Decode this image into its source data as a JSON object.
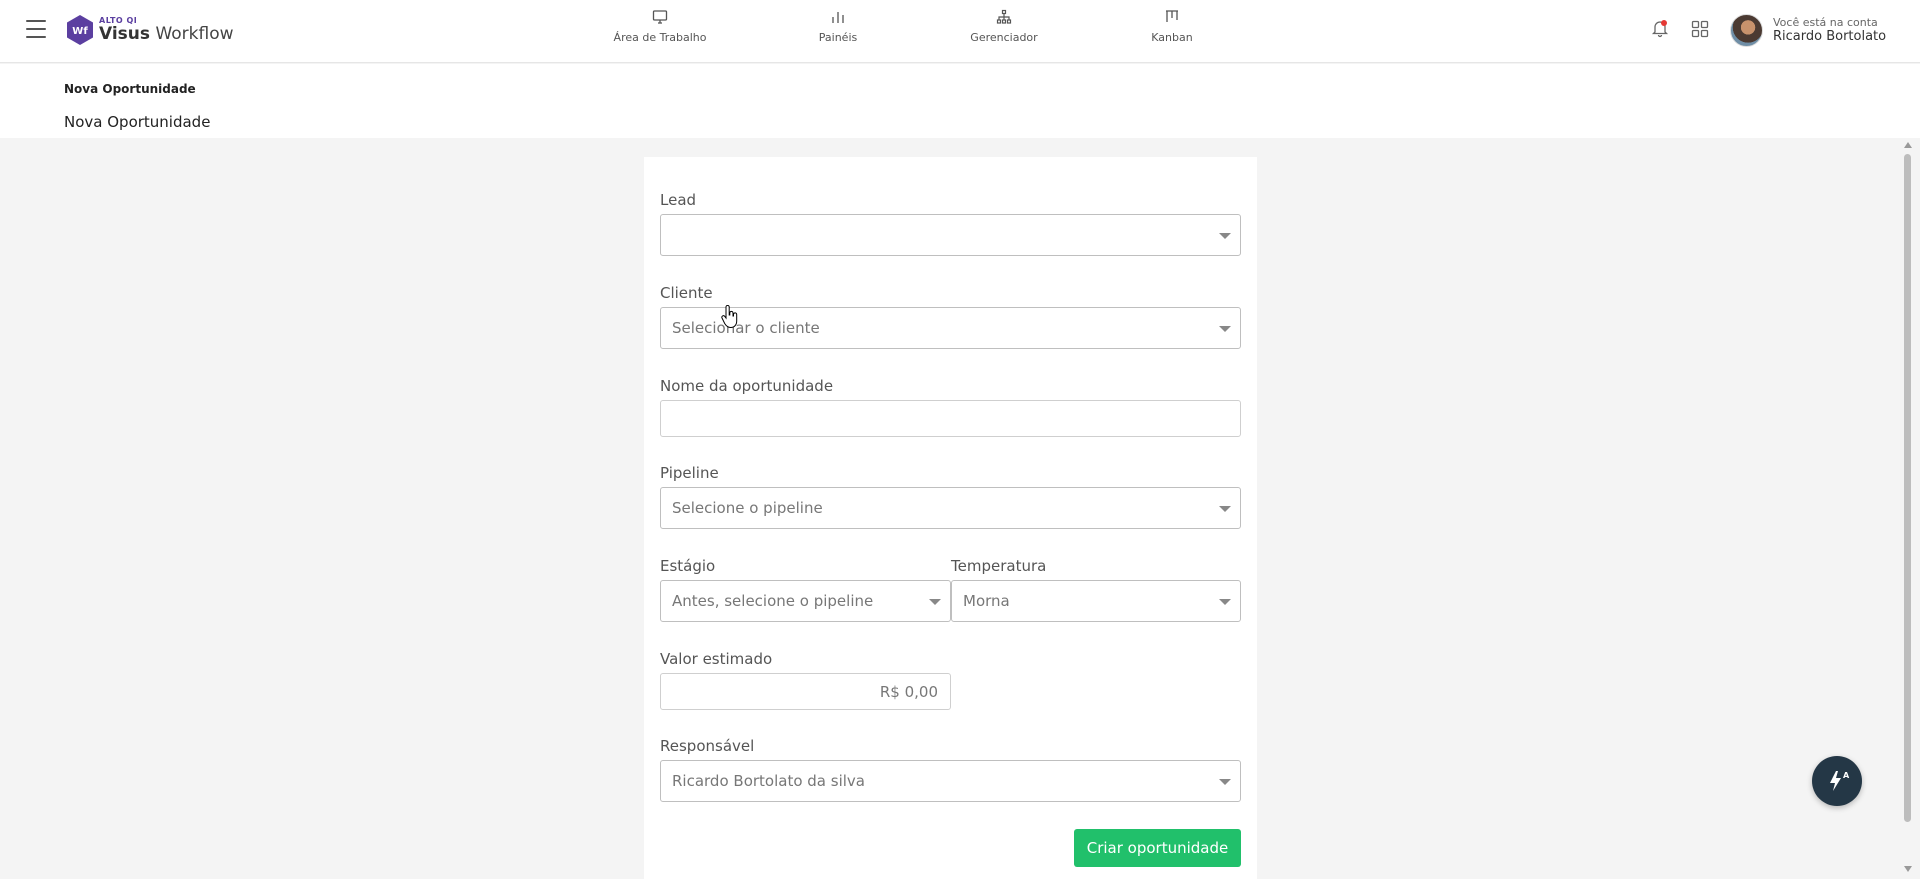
{
  "app": {
    "brand_small": "ALTO QI",
    "brand_bold": "Visus",
    "brand_light": "Workflow",
    "logo_letters": "Wf"
  },
  "nav": {
    "items": [
      {
        "label": "Área de Trabalho",
        "icon": "monitor-icon"
      },
      {
        "label": "Painéis",
        "icon": "bar-chart-icon"
      },
      {
        "label": "Gerenciador",
        "icon": "hierarchy-icon"
      },
      {
        "label": "Kanban",
        "icon": "kanban-icon"
      }
    ]
  },
  "account": {
    "caption": "Você está na conta",
    "name": "Ricardo Bortolato"
  },
  "page": {
    "breadcrumb": "Nova Oportunidade",
    "title": "Nova Oportunidade"
  },
  "form": {
    "lead": {
      "label": "Lead",
      "value": ""
    },
    "cliente": {
      "label": "Cliente",
      "placeholder": "Selecionar o cliente"
    },
    "nome": {
      "label": "Nome da oportunidade",
      "value": ""
    },
    "pipeline": {
      "label": "Pipeline",
      "placeholder": "Selecione o pipeline"
    },
    "estagio": {
      "label": "Estágio",
      "placeholder": "Antes, selecione o pipeline"
    },
    "temperatura": {
      "label": "Temperatura",
      "value": "Morna"
    },
    "valor": {
      "label": "Valor estimado",
      "value": "R$ 0,00"
    },
    "responsavel": {
      "label": "Responsável",
      "value": "Ricardo Bortolato da silva"
    },
    "submit_label": "Criar oportunidade"
  },
  "colors": {
    "brand_purple": "#5b3fa0",
    "primary_green": "#21c06b",
    "fab_dark": "#243746",
    "notification_red": "#e53935"
  }
}
